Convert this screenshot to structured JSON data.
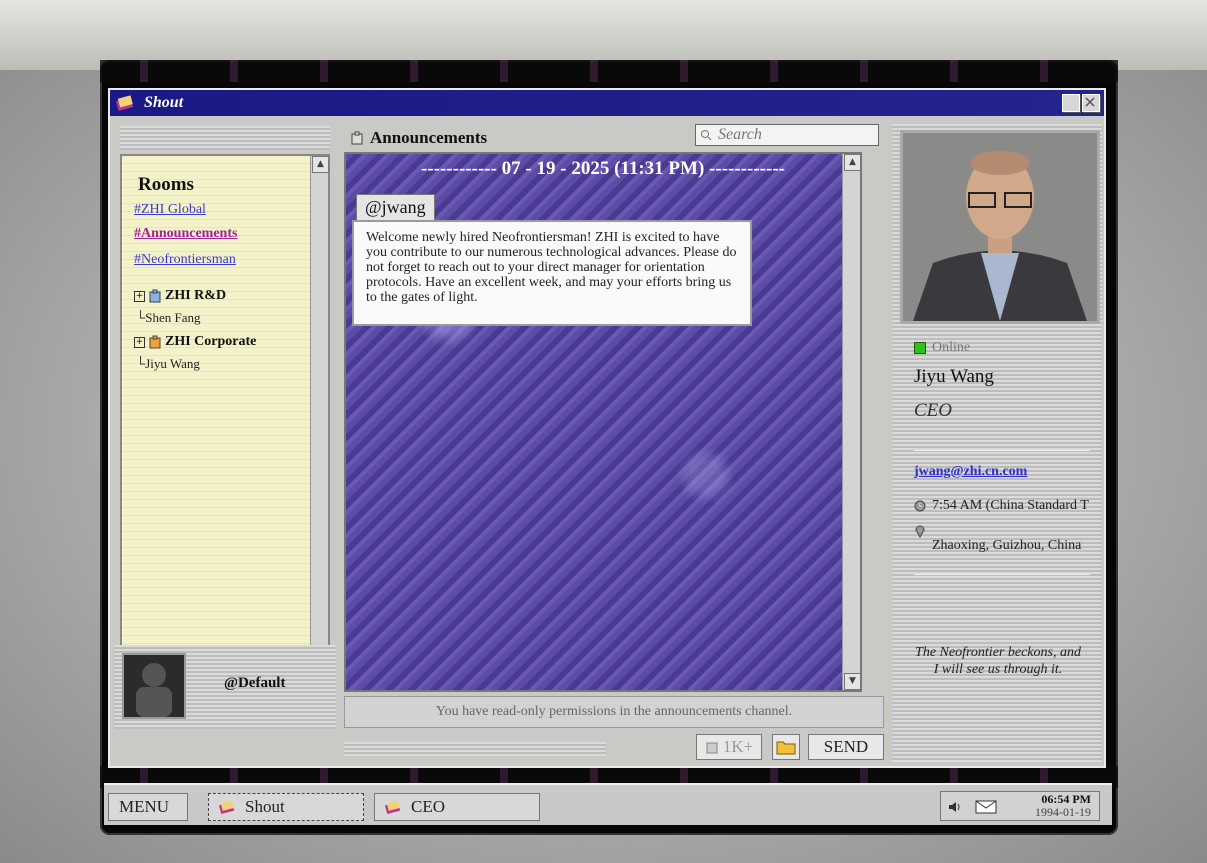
{
  "window": {
    "title": "Shout"
  },
  "rooms": {
    "heading": "Rooms",
    "channels": [
      "#ZHI Global",
      "#Announcements",
      "#Neofrontiersman"
    ],
    "groups": [
      {
        "name": "ZHI R&D",
        "member": "Shen Fang"
      },
      {
        "name": "ZHI Corporate",
        "member": "Jiyu Wang"
      }
    ]
  },
  "current_user": {
    "handle": "@Default"
  },
  "channel": {
    "title": "Announcements",
    "search_placeholder": "Search",
    "date_separator": "------------ 07 - 19 - 2025 (11:31 PM) ------------",
    "message": {
      "author": "@jwang",
      "text": "Welcome newly hired Neofrontiersman! ZHI is excited to have you contribute to our numerous technological advances. Please do not forget to reach out to your direct manager for orientation protocols. Have an excellent week, and may your efforts bring us to the gates of light."
    },
    "notice": "You have read-only permissions in the announcements channel.",
    "count_label": "1K+",
    "send_label": "SEND"
  },
  "profile": {
    "status": "Online",
    "name": "Jiyu Wang",
    "title": "CEO",
    "email": "jwang@zhi.cn.com",
    "local_time": "7:54 AM (China Standard T",
    "location": "Zhaoxing, Guizhou, China",
    "quote_line1": "The Neofrontier beckons, and",
    "quote_line2": "I will see us through it."
  },
  "taskbar": {
    "menu_label": "MENU",
    "tasks": [
      "Shout",
      "CEO"
    ],
    "clock_time": "06:54 PM",
    "clock_date": "1994-01-19"
  },
  "colors": {
    "titlebar": "#1a1a86",
    "online": "#2fc21e",
    "link": "#3a3ad0",
    "active_link": "#a0229a",
    "chat_bg": "#5d4ca6"
  }
}
